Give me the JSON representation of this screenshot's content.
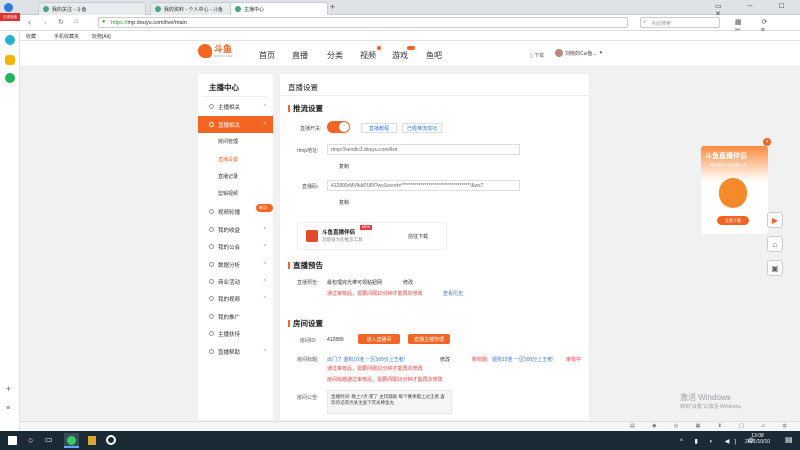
{
  "browser": {
    "tabs": [
      {
        "label": "我的关注 - 斗鱼"
      },
      {
        "label": "我的资料 - 个人中心 - 斗鱼"
      },
      {
        "label": "主播中心"
      }
    ],
    "url_prefix": "https://",
    "url": "mp.douyu.com/live/main",
    "search_placeholder": "点此搜索",
    "bookmarks": [
      "收藏",
      "手机收藏夹",
      "玩物[Alt]"
    ],
    "left_badge": "沉浸阅读"
  },
  "header": {
    "logo_text": "斗鱼",
    "logo_sub": "DOUYU.COM",
    "nav": [
      "首页",
      "直播",
      "分类",
      "视频",
      "游戏",
      "鱼吧"
    ],
    "download": "下载",
    "user": "刘晓的Cui鱼..."
  },
  "sidebar": {
    "title": "主播中心",
    "items": [
      {
        "label": "主播相关"
      },
      {
        "label": "直播相关"
      },
      {
        "label": "视频轮播"
      },
      {
        "label": "我的收益"
      },
      {
        "label": "我的公会"
      },
      {
        "label": "数据分析"
      },
      {
        "label": "商业活动"
      },
      {
        "label": "我的视频"
      },
      {
        "label": "我的推广"
      },
      {
        "label": "主播扶持"
      },
      {
        "label": "直播帮助"
      }
    ],
    "sub_items": [
      "房间管理",
      "直播设置",
      "直播记录",
      "剪辑视频"
    ],
    "badge": "新功能"
  },
  "main": {
    "page_title": "直播设置",
    "stream": {
      "title": "推流设置",
      "switch_label": "直播开关:",
      "tutorial_btn": "直播教程",
      "multi_btn": "已经推流成功",
      "rtmp_label": "rtmp地址:",
      "rtmp_value": "rtmp://sendtc3.douyu.com/live",
      "copy": "复制",
      "code_label": "直播码:",
      "code_value": "412899rMVIkkPUlN?wsSecret=************************************&wsT",
      "app_name": "斗鱼直播伴侣",
      "app_new": "NEW",
      "app_desc": "功能强大的推流工具",
      "app_download": "前往下载"
    },
    "notice": {
      "title": "直播预告",
      "label": "直播预告:",
      "value": "最包理完光棒可领粘鈕网",
      "edit": "修改",
      "warn1": "通过审核后，需要间隔10分钟才能再次修改",
      "history": "查看历史"
    },
    "room": {
      "title": "房间设置",
      "id_label": "房间ID:",
      "id_value": "412899",
      "enter_btn": "进入直播间",
      "apply_btn": "直播主播管理",
      "title_label": "房间标题:",
      "title_value": "出门了 遛狗10连 一区500分上王者!",
      "title_edit": "修改",
      "new_title_label": "新标题:",
      "new_title_value": "遛狗10连 一区500分上王者!",
      "review": "审核中",
      "warn2": "通过审核后，需要间隔10分钟才能再次修改",
      "warn3": "房间标题通过审核后，需要间隔10分钟才能再次修改",
      "announce_label": "房间公告:",
      "announce_value": "直播时间: 晚上7点-累了 主玩辅助 每个赛季都上过王者 喜欢的记得点关注送下荧光棒鱼丸"
    }
  },
  "promo": {
    "title": "斗鱼直播伴侣",
    "subtitle": "最好用的PC端直播工具",
    "btn": "立即下载"
  },
  "windows": {
    "activate": "激活 Windows",
    "activate_sub": "转到\"设置\"以激活 Windows。"
  },
  "taskbar": {
    "time": "13:08",
    "date": "2021/10/10"
  },
  "colors": {
    "accent": "#f26522",
    "link": "#3a7bd5",
    "warn": "#e83d3d"
  }
}
